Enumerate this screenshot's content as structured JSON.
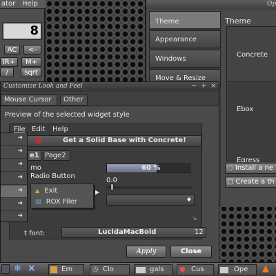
{
  "calculator": {
    "menu_title_fragment": "ator",
    "menu_help": "Help",
    "display": "8",
    "key_ac": "AC",
    "key_back": "<-",
    "key_mr": "IR+",
    "key_mplus": "M+",
    "key_slash": "/",
    "key_sqrt": "sqrt"
  },
  "options_window": {
    "title": "Op",
    "sidebar": [
      "Theme",
      "Appearance",
      "Windows",
      "Move & Resize"
    ],
    "selected_sidebar": 0,
    "panel_title": "Theme",
    "themes": [
      "Concrete",
      "Ebox",
      "Egress"
    ],
    "install_button": "Install a ne",
    "create_button": "Create a th"
  },
  "customize_window": {
    "title": "Customize Look and Feel",
    "tabs": [
      "Mouse Cursor",
      "Other"
    ],
    "preview_heading": "Preview of the selected widget style",
    "preview_menu": [
      "File",
      "Edit",
      "Help"
    ],
    "preview_toolbar_text": "Get a Solid Base with Concrete!",
    "preview_tabs": [
      "e1",
      "Page2"
    ],
    "preview_label_mo": "mo",
    "preview_radio_label": "Radio Button",
    "progress_text": "60 %",
    "progress_value": 0.6,
    "slider_value": "0.0",
    "popup_items": [
      {
        "icon": "exit-icon",
        "label": "Exit"
      },
      {
        "icon": "rox-filer-icon",
        "label": "ROX Filer"
      }
    ],
    "font_label": "t font:",
    "font_name": "LucidaMacBold",
    "font_size": "12",
    "apply_button": "Apply",
    "close_button": "Close"
  },
  "taskbar": {
    "items": [
      "Em",
      "Clo",
      "gals",
      "Cus",
      "Ope"
    ]
  }
}
